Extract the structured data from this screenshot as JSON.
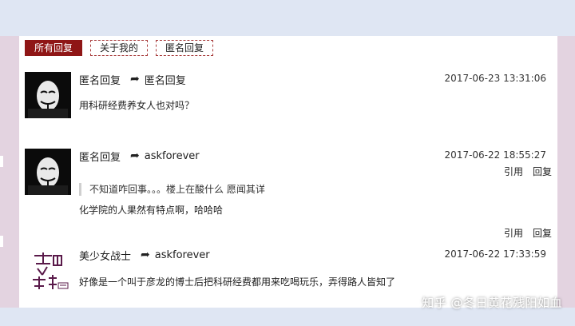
{
  "tabs": [
    {
      "label": "所有回复",
      "active": true
    },
    {
      "label": "关于我的",
      "active": false
    },
    {
      "label": "匿名回复",
      "active": false
    }
  ],
  "replies": [
    {
      "author": "匿名回复",
      "reply_to": "匿名回复",
      "time": "2017-06-23 13:31:06",
      "quote": "",
      "content": "用科研经费养女人也对吗？",
      "actions": {
        "quote": "引用",
        "reply": "回复"
      },
      "avatar_icon": "mask-avatar-icon"
    },
    {
      "author": "匿名回复",
      "reply_to": "askforever",
      "time": "2017-06-22 18:55:27",
      "quote": "不知道咋回事。。。楼上在酸什么  愿闻其详",
      "content": "化学院的人果然有特点啊，哈哈哈",
      "actions": {
        "quote": "引用",
        "reply": "回复"
      },
      "avatar_icon": "mask-avatar-icon"
    },
    {
      "author": "美少女战士",
      "reply_to": "askforever",
      "time": "2017-06-22 17:33:59",
      "quote": "",
      "content": "好像是一个叫于彦龙的博士后把科研经费都用来吃喝玩乐，弄得路人皆知了",
      "actions": {},
      "avatar_icon": "calligraphy-logo-avatar-icon"
    }
  ],
  "reply_arrow_icon": "share-arrow-icon",
  "watermark": "知乎 @冬日黄花残阳如血",
  "colors": {
    "accent": "#8f1616",
    "background": "#dfe6f3",
    "side": "#e3d3e0"
  }
}
